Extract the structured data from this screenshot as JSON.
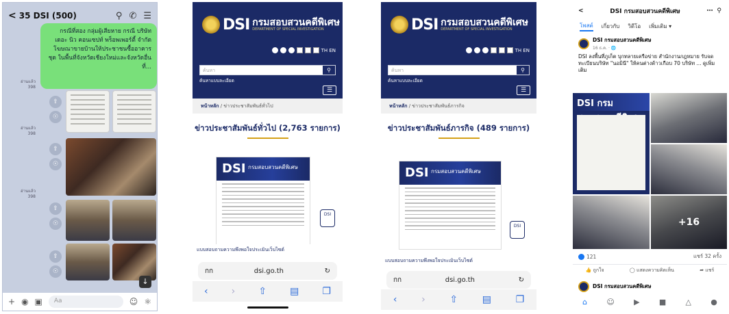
{
  "line": {
    "title": "35  DSI (500)",
    "back_icon": "<",
    "green_message": "กรณีที่สอง กลุ่มผู้เสียหาย กรณี บริษัท เดอะ นิว คอนเซปท์ พร็อพเพอร์ตี้ จำกัด โฆษณาขายบ้านให้ประชาชนซื้ออาคารชุด ในพื้นที่จังหวัดเชียงใหม่และจังหวัดอื่นที่...",
    "read_label": "อ่านแล้ว 398",
    "input_placeholder": "Aa"
  },
  "dsi_page1": {
    "brand": "DSI",
    "brand_th": "กรมสอบสวนคดีพิเศษ",
    "brand_en": "DEPARTMENT OF SPECIAL INVESTIGATION",
    "lang": "TH   EN",
    "search_placeholder": "ค้นหา",
    "advanced_search": "ค้นหาแบบละเอียด",
    "crumb_home": "หน้าหลัก",
    "crumb_current": "ข่าวประชาสัมพันธ์ทั่วไป",
    "section_title": "ข่าวประชาสัมพันธ์ทั่วไป (2,763 รายการ)",
    "survey": "แบบสอบถามความพึงพอใจประเมินเว็บไซต์",
    "url": "dsi.go.th",
    "aa": "กก"
  },
  "dsi_page2": {
    "brand": "DSI",
    "brand_th": "กรมสอบสวนคดีพิเศษ",
    "brand_en": "DEPARTMENT OF SPECIAL INVESTIGATION",
    "lang": "TH   EN",
    "search_placeholder": "ค้นหา",
    "advanced_search": "ค้นหาแบบละเอียด",
    "crumb_home": "หน้าหลัก",
    "crumb_current": "ข่าวประชาสัมพันธ์ภารกิจ",
    "section_title": "ข่าวประชาสัมพันธ์ภารกิจ (489 รายการ)",
    "survey": "แบบสอบถามความพึงพอใจประเมินเว็บไซต์",
    "url": "dsi.go.th",
    "aa": "กก"
  },
  "facebook": {
    "title": "DSI กรมสอบสวนคดีพิเศษ",
    "tabs": [
      "โพสต์",
      "เกี่ยวกับ",
      "วิดีโอ",
      "เพิ่มเติม ▾"
    ],
    "page_name": "DSI กรมสอบสวนคดีพิเศษ",
    "post_date": "16 ธ.ค. · 🌐",
    "post_text": "DSI ลงพื้นที่ภูเก็ต บุกทลายเครือข่าย สำนักงานกฎหมาย รับจดทะเบียนบริษัท \"นอมินี\" ให้คนต่างด้าวเกือบ 70 บริษัท ... ดูเพิ่มเติม",
    "more_photos": "+16",
    "reactions": "121",
    "shares": "แชร์ 32 ครั้ง",
    "like": "ถูกใจ",
    "comment": "แสดงความคิดเห็น",
    "share": "แชร์",
    "next_page_name": "DSI กรมสอบสวนคดีพิเศษ"
  }
}
